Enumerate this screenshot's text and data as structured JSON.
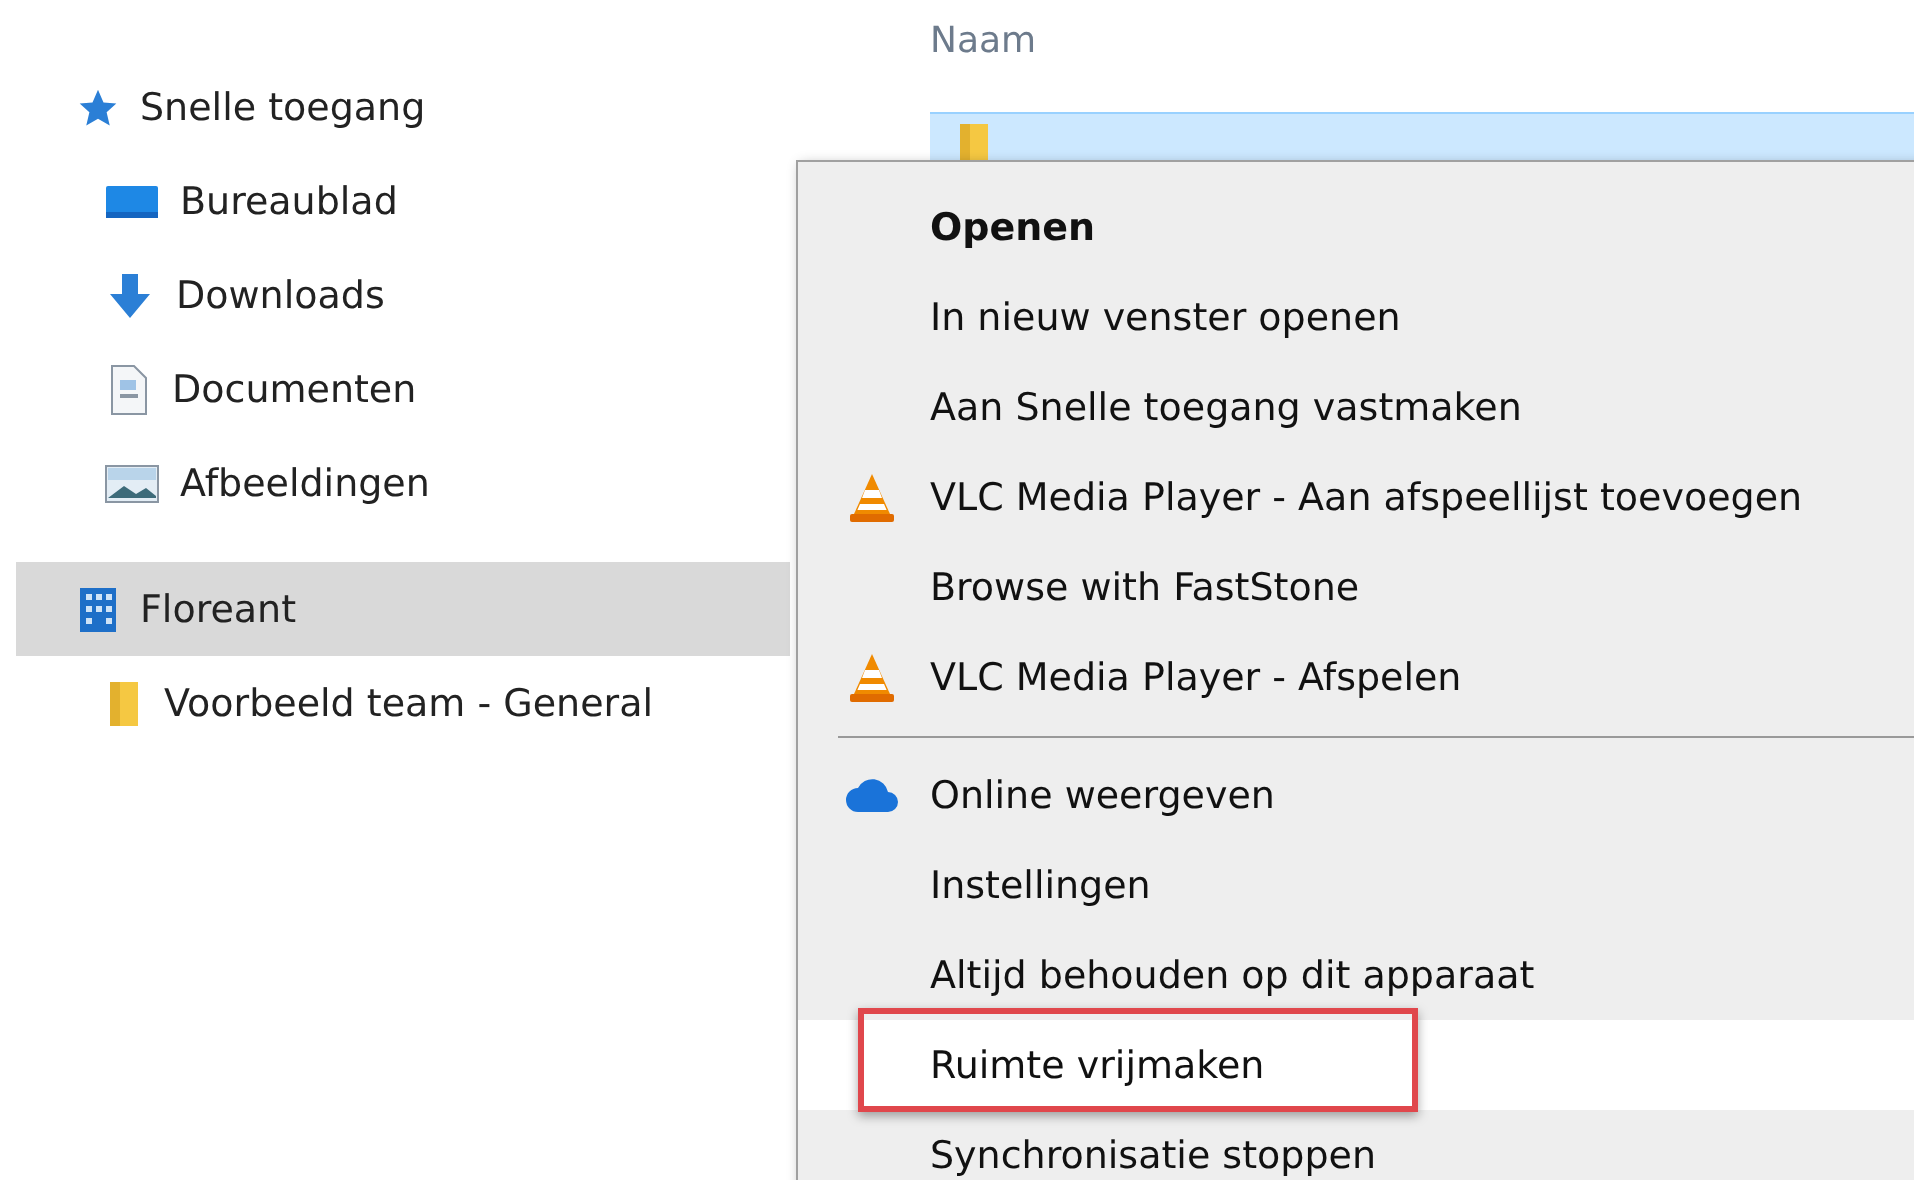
{
  "sidebar": {
    "items": [
      {
        "label": "Snelle toegang",
        "kind": "star",
        "selected": false,
        "children": [
          {
            "label": "Bureaublad",
            "kind": "desktop",
            "selected": false
          },
          {
            "label": "Downloads",
            "kind": "download",
            "selected": false
          },
          {
            "label": "Documenten",
            "kind": "document",
            "selected": false
          },
          {
            "label": "Afbeeldingen",
            "kind": "pictures",
            "selected": false
          }
        ]
      },
      {
        "label": "Floreant",
        "kind": "building",
        "selected": true,
        "children": [
          {
            "label": "Voorbeeld team - General",
            "kind": "folder",
            "selected": false
          }
        ]
      }
    ]
  },
  "file_list": {
    "columns": [
      "Naam"
    ],
    "rows": [
      {
        "selected": true
      }
    ]
  },
  "context_menu": {
    "items": [
      {
        "kind": "plain",
        "label": "Openen",
        "bold": true,
        "selected": false,
        "outlined": false
      },
      {
        "kind": "plain",
        "label": "In nieuw venster openen",
        "bold": false,
        "selected": false,
        "outlined": false
      },
      {
        "kind": "plain",
        "label": "Aan Snelle toegang vastmaken",
        "bold": false,
        "selected": false,
        "outlined": false
      },
      {
        "kind": "vlc",
        "label": "VLC Media Player - Aan afspeellijst toevoegen",
        "bold": false,
        "selected": false,
        "outlined": false
      },
      {
        "kind": "plain",
        "label": "Browse with FastStone",
        "bold": false,
        "selected": false,
        "outlined": false
      },
      {
        "kind": "vlc",
        "label": "VLC Media Player - Afspelen",
        "bold": false,
        "selected": false,
        "outlined": false
      },
      {
        "kind": "separator"
      },
      {
        "kind": "cloud",
        "label": "Online weergeven",
        "bold": false,
        "selected": false,
        "outlined": false
      },
      {
        "kind": "plain",
        "label": "Instellingen",
        "bold": false,
        "selected": false,
        "outlined": false
      },
      {
        "kind": "plain",
        "label": "Altijd behouden op dit apparaat",
        "bold": false,
        "selected": false,
        "outlined": false
      },
      {
        "kind": "plain",
        "label": "Ruimte vrijmaken",
        "bold": false,
        "selected": true,
        "outlined": true
      },
      {
        "kind": "plain",
        "label": "Synchronisatie stoppen",
        "bold": false,
        "selected": false,
        "outlined": false
      }
    ]
  }
}
